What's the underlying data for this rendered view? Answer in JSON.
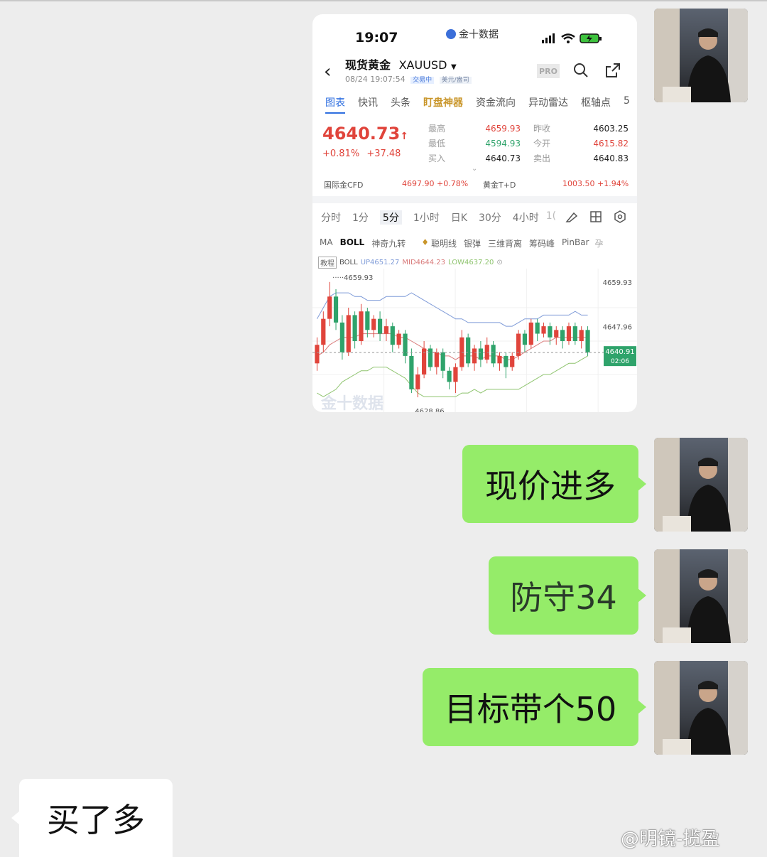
{
  "phone": {
    "time": "19:07",
    "app_source": "金十数据",
    "status_icons": [
      "signal-icon",
      "wifi-icon",
      "battery-charging-icon"
    ],
    "instrument_name": "现货黄金",
    "instrument_code": "XAUUSD",
    "datetime": "08/24 19:07:54",
    "trade_status": "交易中",
    "unit": "美元/盎司",
    "pro_badge": "PRO",
    "tabs": [
      "图表",
      "快讯",
      "头条",
      "盯盘神器",
      "资金流向",
      "异动雷达",
      "枢轴点",
      "5"
    ],
    "price": "4640.73",
    "change_pct": "+0.81%",
    "change_abs": "+37.48",
    "stats": [
      {
        "label": "最高",
        "value": "4659.93",
        "label2": "昨收",
        "value2": "4603.25"
      },
      {
        "label": "最低",
        "value": "4594.93",
        "label2": "今开",
        "value2": "4615.82"
      },
      {
        "label": "买入",
        "value": "4640.73",
        "label2": "卖出",
        "value2": "4640.83"
      }
    ],
    "cfd_label": "国际金CFD",
    "cfd_value": "4697.90  +0.78%",
    "td_label": "黄金T+D",
    "td_value": "1003.50  +1.94%",
    "timeframes": [
      "分时",
      "1分",
      "5分",
      "1小时",
      "日K",
      "30分",
      "4小时",
      "1("
    ],
    "indicators": [
      "MA",
      "BOLL",
      "神奇九转",
      "聪明线",
      "银弹",
      "三维背离",
      "筹码峰",
      "PinBar",
      "孕"
    ],
    "tutorial_label": "教程",
    "boll_label": "BOLL",
    "boll_up": "UP4651.27",
    "boll_mid": "MID4644.23",
    "boll_low": "LOW4637.20",
    "chart_watermark": "金十数据",
    "colors": {
      "up": "#e0443b",
      "down": "#2fa36b",
      "tab_active": "#2f6fe0",
      "mid": "#d97a7a",
      "band": "#7f9bd8"
    }
  },
  "chart_data": {
    "type": "candlestick",
    "y_ticks": [
      "4659.93",
      "4647.96",
      "4640.91",
      "4628.86"
    ],
    "current_price": "4640.91",
    "countdown": "02:06",
    "high_label": "4659.93",
    "low_label": "4628.86",
    "ylim": [
      4626,
      4662
    ],
    "candles": [
      {
        "o": 4638,
        "c": 4643,
        "h": 4645,
        "l": 4636
      },
      {
        "o": 4643,
        "c": 4650,
        "h": 4652,
        "l": 4641
      },
      {
        "o": 4650,
        "c": 4656,
        "h": 4659.93,
        "l": 4648
      },
      {
        "o": 4656,
        "c": 4649,
        "h": 4658,
        "l": 4647
      },
      {
        "o": 4649,
        "c": 4641,
        "h": 4651,
        "l": 4639
      },
      {
        "o": 4641,
        "c": 4651,
        "h": 4653,
        "l": 4640
      },
      {
        "o": 4651,
        "c": 4644,
        "h": 4652,
        "l": 4642
      },
      {
        "o": 4644,
        "c": 4652,
        "h": 4654,
        "l": 4643
      },
      {
        "o": 4652,
        "c": 4647,
        "h": 4653,
        "l": 4645
      },
      {
        "o": 4647,
        "c": 4650,
        "h": 4651,
        "l": 4645
      },
      {
        "o": 4650,
        "c": 4646,
        "h": 4652,
        "l": 4644
      },
      {
        "o": 4646,
        "c": 4648,
        "h": 4650,
        "l": 4644
      },
      {
        "o": 4648,
        "c": 4643,
        "h": 4649,
        "l": 4641
      },
      {
        "o": 4643,
        "c": 4646,
        "h": 4647,
        "l": 4642
      },
      {
        "o": 4646,
        "c": 4640,
        "h": 4647,
        "l": 4638
      },
      {
        "o": 4640,
        "c": 4631,
        "h": 4642,
        "l": 4630
      },
      {
        "o": 4631,
        "c": 4635,
        "h": 4637,
        "l": 4628.86
      },
      {
        "o": 4635,
        "c": 4642,
        "h": 4644,
        "l": 4634
      },
      {
        "o": 4642,
        "c": 4637,
        "h": 4643,
        "l": 4636
      },
      {
        "o": 4637,
        "c": 4641,
        "h": 4642,
        "l": 4635
      },
      {
        "o": 4641,
        "c": 4636,
        "h": 4642,
        "l": 4634
      },
      {
        "o": 4636,
        "c": 4633,
        "h": 4637,
        "l": 4631
      },
      {
        "o": 4633,
        "c": 4637,
        "h": 4638,
        "l": 4630
      },
      {
        "o": 4637,
        "c": 4645,
        "h": 4647,
        "l": 4636
      },
      {
        "o": 4645,
        "c": 4638,
        "h": 4646,
        "l": 4637
      },
      {
        "o": 4638,
        "c": 4642,
        "h": 4643,
        "l": 4636
      },
      {
        "o": 4642,
        "c": 4639,
        "h": 4644,
        "l": 4637
      },
      {
        "o": 4639,
        "c": 4643,
        "h": 4645,
        "l": 4638
      },
      {
        "o": 4643,
        "c": 4638,
        "h": 4644,
        "l": 4637
      },
      {
        "o": 4638,
        "c": 4640,
        "h": 4641,
        "l": 4636
      },
      {
        "o": 4640,
        "c": 4637,
        "h": 4641,
        "l": 4634
      },
      {
        "o": 4637,
        "c": 4640,
        "h": 4641,
        "l": 4636
      },
      {
        "o": 4640,
        "c": 4646,
        "h": 4647,
        "l": 4639
      },
      {
        "o": 4646,
        "c": 4643,
        "h": 4647,
        "l": 4641
      },
      {
        "o": 4643,
        "c": 4649,
        "h": 4650,
        "l": 4642
      },
      {
        "o": 4649,
        "c": 4646,
        "h": 4650,
        "l": 4644
      },
      {
        "o": 4646,
        "c": 4648,
        "h": 4649,
        "l": 4645
      },
      {
        "o": 4648,
        "c": 4645,
        "h": 4649,
        "l": 4643
      },
      {
        "o": 4645,
        "c": 4647,
        "h": 4648,
        "l": 4643
      },
      {
        "o": 4647,
        "c": 4644,
        "h": 4648,
        "l": 4642
      },
      {
        "o": 4644,
        "c": 4648,
        "h": 4649,
        "l": 4643
      },
      {
        "o": 4648,
        "c": 4644,
        "h": 4649,
        "l": 4643
      },
      {
        "o": 4644,
        "c": 4647,
        "h": 4648,
        "l": 4642
      },
      {
        "o": 4647,
        "c": 4641,
        "h": 4648,
        "l": 4640
      }
    ],
    "boll_upper": [
      4650,
      4653,
      4656,
      4657,
      4657,
      4657,
      4656,
      4656,
      4655,
      4655,
      4655,
      4656,
      4656,
      4656,
      4656,
      4657,
      4656,
      4655,
      4654,
      4653,
      4652,
      4651,
      4650,
      4650,
      4649,
      4649,
      4649,
      4649,
      4649,
      4649,
      4648,
      4648,
      4649,
      4650,
      4650,
      4650,
      4651,
      4651,
      4651,
      4651,
      4651,
      4652,
      4651,
      4651
    ],
    "boll_mid": [
      4640,
      4641,
      4643,
      4644,
      4645,
      4645,
      4645,
      4646,
      4646,
      4646,
      4646,
      4646,
      4646,
      4645,
      4645,
      4644,
      4643,
      4642,
      4641,
      4641,
      4640,
      4640,
      4639,
      4640,
      4640,
      4640,
      4639,
      4640,
      4640,
      4640,
      4639,
      4639,
      4640,
      4641,
      4642,
      4643,
      4644,
      4644,
      4645,
      4645,
      4645,
      4645,
      4645,
      4645
    ],
    "boll_lower": [
      4630,
      4629,
      4630,
      4631,
      4633,
      4634,
      4635,
      4636,
      4636,
      4637,
      4637,
      4637,
      4636,
      4635,
      4634,
      4632,
      4630,
      4629,
      4629,
      4629,
      4629,
      4629,
      4629,
      4630,
      4630,
      4631,
      4630,
      4631,
      4631,
      4631,
      4631,
      4631,
      4631,
      4632,
      4633,
      4634,
      4635,
      4635,
      4636,
      4637,
      4638,
      4638,
      4639,
      4640
    ]
  },
  "chat": {
    "messages": [
      {
        "side": "right",
        "text": "现价进多"
      },
      {
        "side": "right",
        "text": "防守34"
      },
      {
        "side": "right",
        "text": "目标带个50"
      },
      {
        "side": "left",
        "text": "买了多"
      }
    ],
    "watermark": "@明镜-揽盈"
  }
}
